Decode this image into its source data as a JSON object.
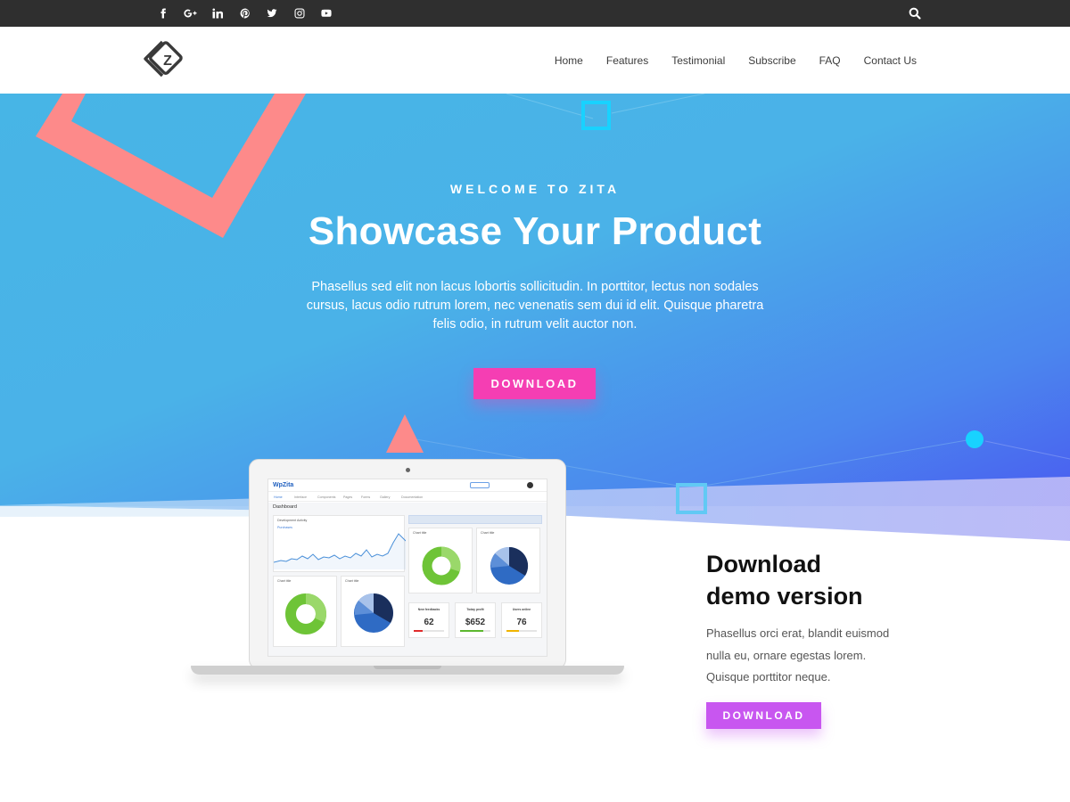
{
  "topbar": {
    "social_icons": [
      "facebook-icon",
      "google-plus-icon",
      "linkedin-icon",
      "pinterest-icon",
      "twitter-icon",
      "instagram-icon",
      "youtube-icon"
    ],
    "search_icon": "search-icon"
  },
  "header": {
    "logo_letter": "Z",
    "nav": [
      "Home",
      "Features",
      "Testimonial",
      "Subscribe",
      "FAQ",
      "Contact Us"
    ]
  },
  "hero": {
    "eyebrow": "WELCOME TO ZITA",
    "title": "Showcase Your Product",
    "description": "Phasellus sed elit non lacus lobortis sollicitudin. In porttitor, lectus non sodales cursus, lacus odio rutrum lorem, nec venenatis sem dui id elit. Quisque pharetra felis odio, in rutrum velit auctor non.",
    "button": "DOWNLOAD",
    "colors": {
      "hero_blue": "#4ab1e6",
      "hero_indigo": "#4a5cf0",
      "accent_pink": "#f53eb3",
      "coral": "#ff8b8b"
    }
  },
  "demo": {
    "title_line1": "Download",
    "title_line2": "demo version",
    "description": "Phasellus orci erat, blandit euismod nulla eu, ornare egestas lorem. Quisque porttitor neque.",
    "button": "DOWNLOAD",
    "button_color": "#c856f0"
  },
  "screen": {
    "brand": "WpZita",
    "nav": [
      "Home",
      "Interface",
      "Components",
      "Pages",
      "Forms",
      "Gallery",
      "Documentation"
    ],
    "page_title": "Dashboard",
    "activity_title": "Development Activity",
    "activity_legend": "Purchases",
    "chart_title_1": "Chart title",
    "chart_title_2": "Chart title",
    "chart_title_3": "Chart title",
    "chart_title_4": "Chart title",
    "stats": [
      {
        "label": "New feedbacks",
        "value": "62",
        "color": "#e02b2b"
      },
      {
        "label": "Today profit",
        "value": "$652",
        "color": "#5cb82f"
      },
      {
        "label": "Users online",
        "value": "76",
        "color": "#f0b400"
      }
    ]
  }
}
